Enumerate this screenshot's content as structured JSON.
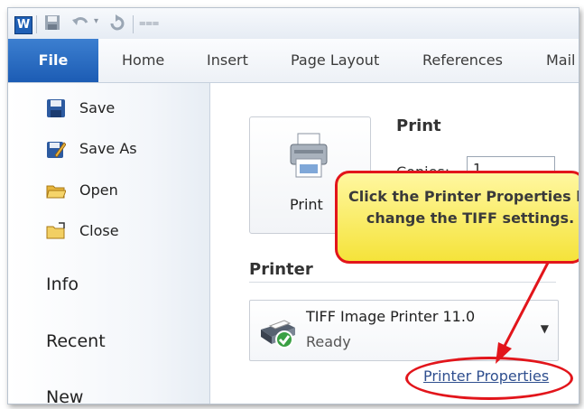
{
  "app": {
    "icon_letter": "W"
  },
  "quick_access": {
    "icons": [
      "save-icon",
      "undo-icon",
      "redo-icon",
      "customize-icon"
    ]
  },
  "ribbon": {
    "tabs": [
      {
        "label": "File",
        "active": true
      },
      {
        "label": "Home"
      },
      {
        "label": "Insert"
      },
      {
        "label": "Page Layout"
      },
      {
        "label": "References"
      },
      {
        "label": "Mail"
      }
    ]
  },
  "backstage": {
    "commands": [
      {
        "label": "Save",
        "icon": "save-icon"
      },
      {
        "label": "Save As",
        "icon": "save-as-icon"
      },
      {
        "label": "Open",
        "icon": "open-folder-icon"
      },
      {
        "label": "Close",
        "icon": "close-folder-icon"
      }
    ],
    "sections": [
      {
        "label": "Info"
      },
      {
        "label": "Recent"
      },
      {
        "label": "New"
      }
    ]
  },
  "print_panel": {
    "print_button_label": "Print",
    "heading": "Print",
    "copies_label": "Copies:",
    "copies_value": "1",
    "printer_heading": "Printer",
    "printer_name": "TIFF Image Printer 11.0",
    "printer_status": "Ready",
    "printer_properties_link": "Printer Properties"
  },
  "callout": {
    "line1": "Click the Printer Properties link to",
    "line2": "change the TIFF settings.",
    "border_color": "#e2151b",
    "fill_color": "#f5e33a"
  },
  "colors": {
    "file_tab": "#1c5cb4",
    "accent_red": "#e2151b",
    "link": "#2f4f8f"
  }
}
